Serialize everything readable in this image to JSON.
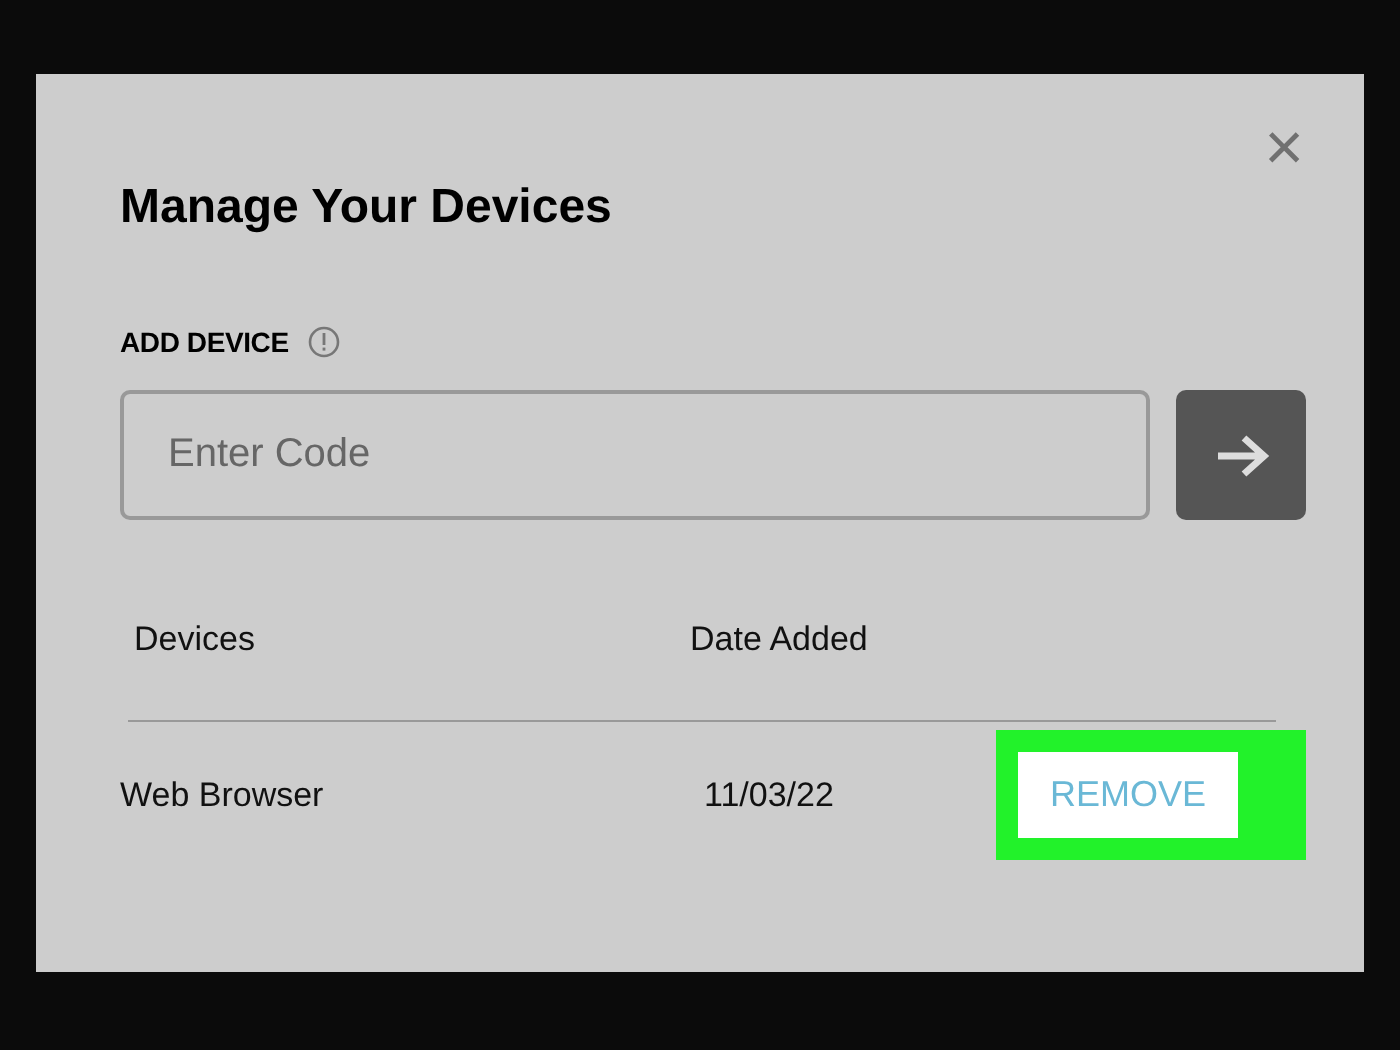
{
  "dialog": {
    "title": "Manage Your Devices",
    "close": "×"
  },
  "add_device": {
    "label": "ADD DEVICE",
    "placeholder": "Enter Code"
  },
  "table": {
    "columns": [
      "Devices",
      "Date Added"
    ],
    "rows": [
      {
        "device": "Web Browser",
        "date_added": "11/03/22",
        "action": "REMOVE",
        "highlighted": true
      }
    ]
  }
}
